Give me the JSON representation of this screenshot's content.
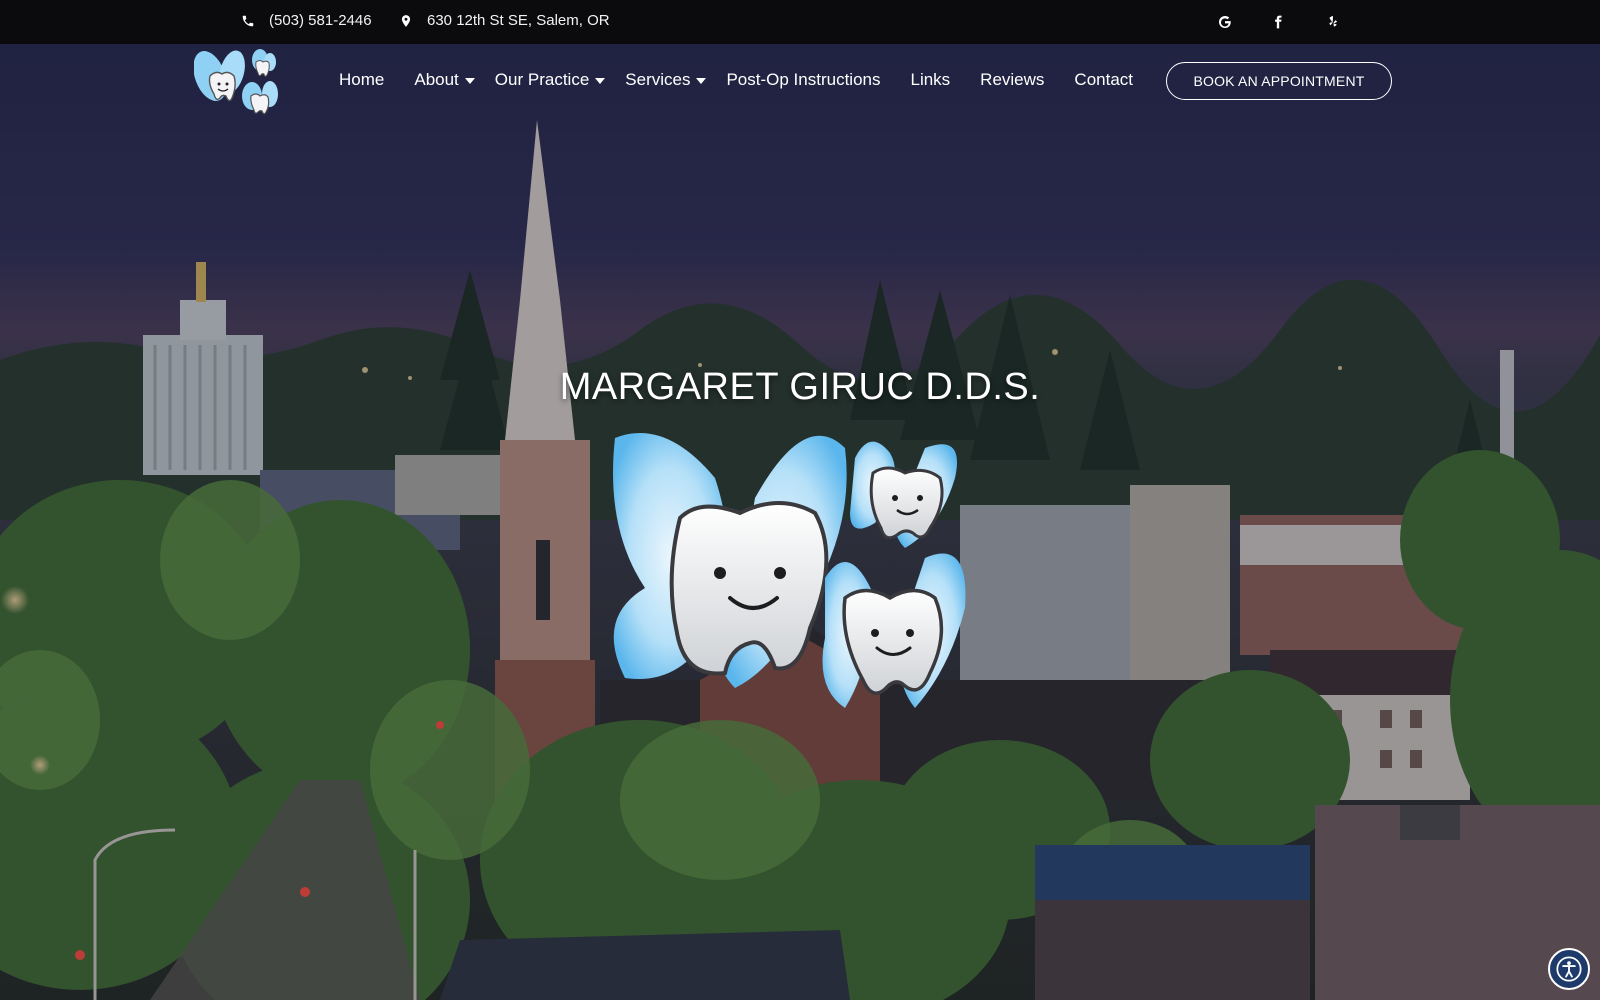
{
  "topbar": {
    "phone": "(503) 581-2446",
    "address": "630 12th St SE, Salem, OR",
    "social": [
      {
        "icon": "google-icon"
      },
      {
        "icon": "facebook-icon"
      },
      {
        "icon": "yelp-icon"
      }
    ]
  },
  "nav": {
    "items": [
      {
        "label": "Home",
        "has_dropdown": false
      },
      {
        "label": "About",
        "has_dropdown": true
      },
      {
        "label": "Our Practice",
        "has_dropdown": true
      },
      {
        "label": "Services",
        "has_dropdown": true
      },
      {
        "label": "Post-Op Instructions",
        "has_dropdown": false
      },
      {
        "label": "Links",
        "has_dropdown": false
      },
      {
        "label": "Reviews",
        "has_dropdown": false
      },
      {
        "label": "Contact",
        "has_dropdown": false
      }
    ],
    "cta": "BOOK AN APPOINTMENT"
  },
  "hero": {
    "title": "MARGARET GIRUC D.D.S."
  },
  "colors": {
    "topbar_bg": "#0b0b0e",
    "wing_blue": "#7cc6f0",
    "sky": "#2b2c4e"
  },
  "accessibility": {
    "icon": "accessibility-icon"
  }
}
